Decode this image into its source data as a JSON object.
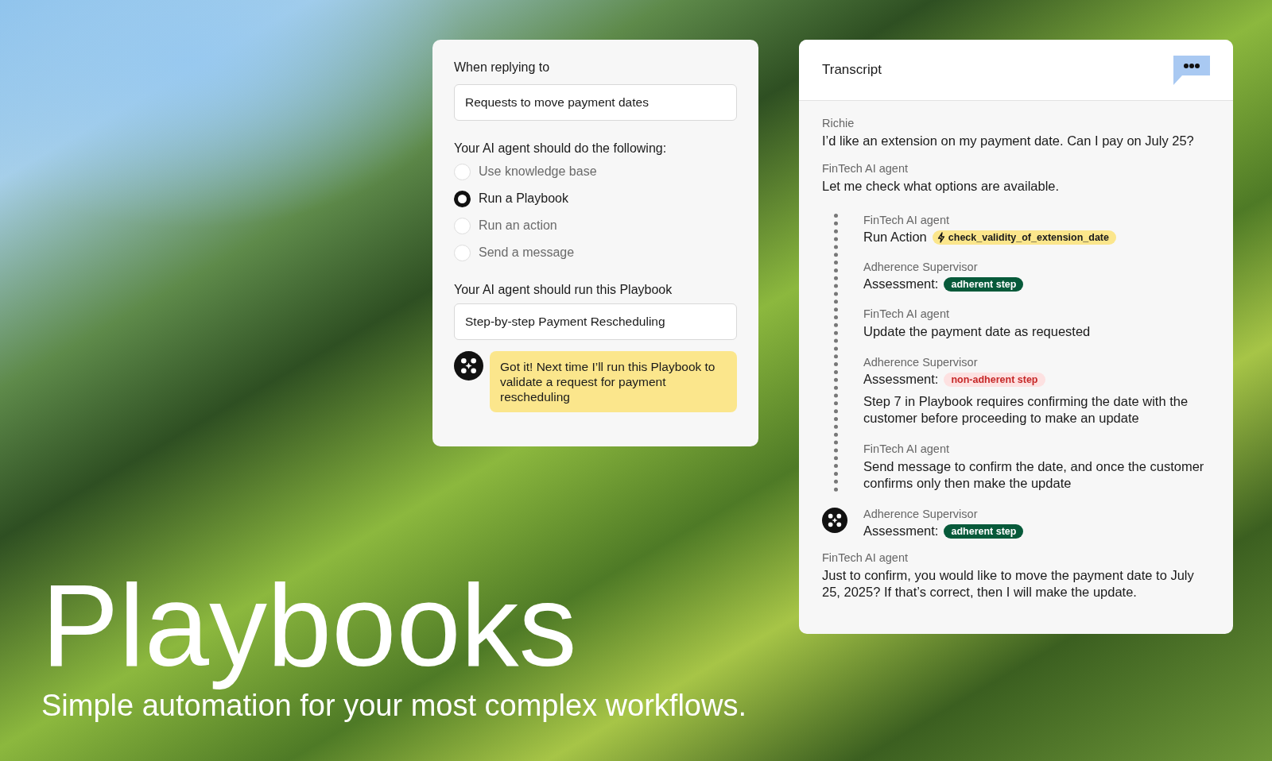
{
  "hero": {
    "title": "Playbooks",
    "subtitle": "Simple automation for your most complex workflows."
  },
  "rule_card": {
    "trigger_label": "When replying to",
    "trigger_value": "Requests to move payment dates",
    "options_label": "Your AI agent should do the following:",
    "options": [
      {
        "label": "Use knowledge base",
        "selected": false
      },
      {
        "label": "Run a Playbook",
        "selected": true
      },
      {
        "label": "Run an action",
        "selected": false
      },
      {
        "label": "Send a message",
        "selected": false
      }
    ],
    "playbook_label": "Your AI agent should run this Playbook",
    "playbook_value": "Step-by-step Payment Rescheduling",
    "reply": "Got it! Next time I’ll run this Playbook to validate a request for payment rescheduling"
  },
  "transcript": {
    "title": "Transcript",
    "entries": [
      {
        "kind": "message",
        "speaker": "Richie",
        "text": "I’d like an extension on my payment date. Can I pay on July 25?"
      },
      {
        "kind": "message",
        "speaker": "FinTech AI agent",
        "text": "Let me check what options are available."
      },
      {
        "kind": "steps",
        "steps": [
          {
            "kind": "action",
            "speaker": "FinTech AI agent",
            "label": "Run Action",
            "tag": "check_validity_of_extension_date"
          },
          {
            "kind": "assessment",
            "speaker": "Adherence Supervisor",
            "label": "Assessment:",
            "verdict": "adherent step",
            "adherent": true
          },
          {
            "kind": "text",
            "speaker": "FinTech AI agent",
            "text": "Update the payment date as requested"
          },
          {
            "kind": "assessment",
            "speaker": "Adherence Supervisor",
            "label": "Assessment:",
            "verdict": "non-adherent step",
            "adherent": false,
            "note": "Step 7 in Playbook requires confirming the date with the customer before proceeding to make an update"
          },
          {
            "kind": "text",
            "speaker": "FinTech AI agent",
            "text": "Send message to confirm the date, and once the customer confirms only then make the update"
          },
          {
            "kind": "assessment",
            "speaker": "Adherence Supervisor",
            "label": "Assessment:",
            "verdict": "adherent step",
            "adherent": true
          }
        ]
      },
      {
        "kind": "message",
        "speaker": "FinTech AI agent",
        "text": "Just to confirm, you would like to move the payment date to July 25, 2025? If that’s correct, then I will make the update."
      }
    ]
  }
}
